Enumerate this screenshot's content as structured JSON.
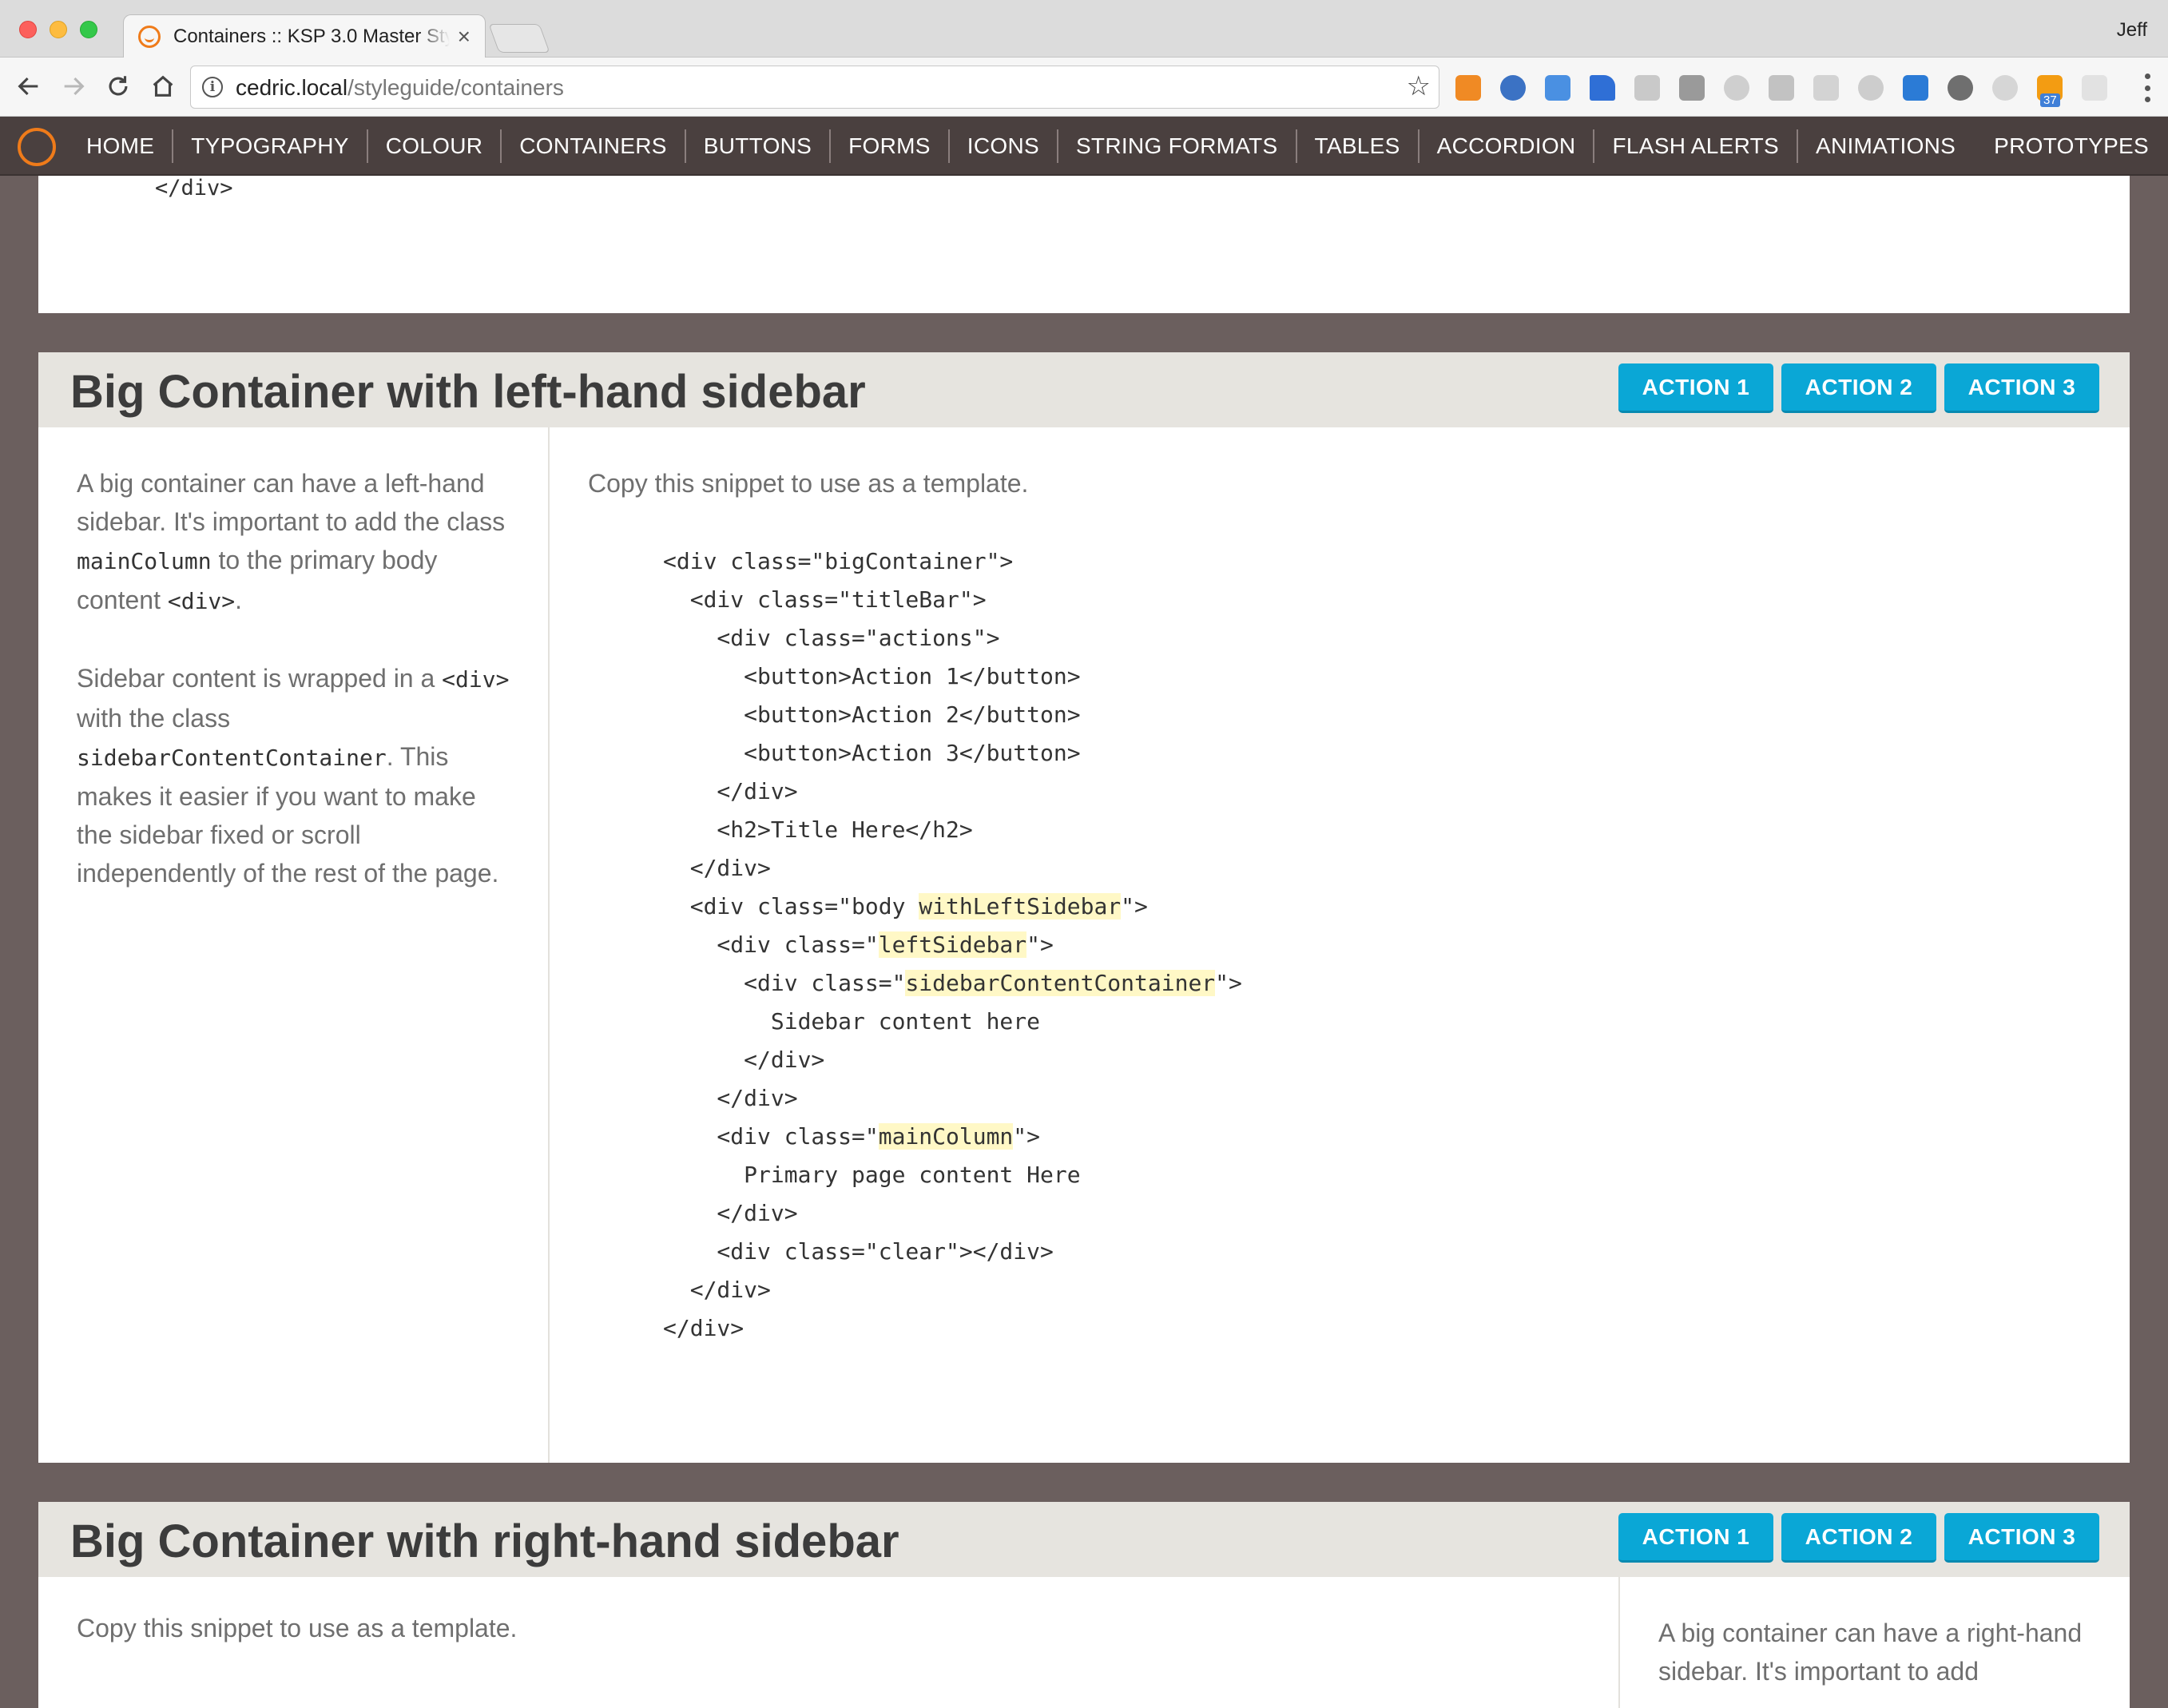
{
  "browser": {
    "tab_title": "Containers :: KSP 3.0 Master Style Guide",
    "tab_close": "×",
    "profile_name": "Jeff",
    "url_host": "cedric.local",
    "url_path": "/styleguide/containers",
    "extension_badge": "37"
  },
  "nav": {
    "items": [
      "HOME",
      "TYPOGRAPHY",
      "COLOUR",
      "CONTAINERS",
      "BUTTONS",
      "FORMS",
      "ICONS",
      "STRING FORMATS",
      "TABLES",
      "ACCORDION",
      "FLASH ALERTS",
      "ANIMATIONS"
    ],
    "right_item": "PROTOTYPES"
  },
  "top_card": {
    "code_tail": "</div>"
  },
  "left_sidebar_card": {
    "title": "Big Container with left-hand sidebar",
    "actions": [
      "ACTION 1",
      "ACTION 2",
      "ACTION 3"
    ],
    "sidebar_p1_a": "A big container can have a left-hand sidebar. It's important to add the class ",
    "sidebar_p1_code1": "mainColumn",
    "sidebar_p1_b": " to the primary body content ",
    "sidebar_p1_code2": "<div>",
    "sidebar_p1_c": ".",
    "sidebar_p2_a": "Sidebar content is wrapped in a ",
    "sidebar_p2_code1": "<div>",
    "sidebar_p2_b": " with the class ",
    "sidebar_p2_code2": "sidebarContentContainer",
    "sidebar_p2_c": ". This makes it easier if you want to make the sidebar fixed or scroll independently of the rest of the page.",
    "intro": "Copy this snippet to use as a template.",
    "code": {
      "l1": "<div class=\"bigContainer\">",
      "l2": "  <div class=\"titleBar\">",
      "l3": "    <div class=\"actions\">",
      "l4": "      <button>Action 1</button>",
      "l5": "      <button>Action 2</button>",
      "l6": "      <button>Action 3</button>",
      "l7": "    </div>",
      "l8": "    <h2>Title Here</h2>",
      "l9": "  </div>",
      "l10a": "  <div class=\"body ",
      "l10b": "withLeftSidebar",
      "l10c": "\">",
      "l11a": "    <div class=\"",
      "l11b": "leftSidebar",
      "l11c": "\">",
      "l12a": "      <div class=\"",
      "l12b": "sidebarContentContainer",
      "l12c": "\">",
      "l13": "        Sidebar content here",
      "l14": "      </div>",
      "l15": "    </div>",
      "l16a": "    <div class=\"",
      "l16b": "mainColumn",
      "l16c": "\">",
      "l17": "      Primary page content Here",
      "l18": "    </div>",
      "l19": "    <div class=\"clear\"></div>",
      "l20": "  </div>",
      "l21": "</div>"
    }
  },
  "right_sidebar_card": {
    "title": "Big Container with right-hand sidebar",
    "actions": [
      "ACTION 1",
      "ACTION 2",
      "ACTION 3"
    ],
    "intro": "Copy this snippet to use as a template.",
    "sidebar_text": "A big container can have a right-hand sidebar. It's important to add"
  },
  "colors": {
    "nav_bg": "#4a403f",
    "page_bg": "#6b5f5e",
    "accent_orange": "#ef7b1a",
    "button_blue": "#0aa7d6",
    "titlebar_bg": "#e6e4df",
    "highlight": "#fff8c6"
  },
  "icons": {
    "back": "arrow-left-icon",
    "forward": "arrow-right-icon",
    "reload": "reload-icon",
    "home": "home-icon",
    "info": "info-icon",
    "bookmark": "star-icon",
    "menu": "more-vertical-icon"
  }
}
